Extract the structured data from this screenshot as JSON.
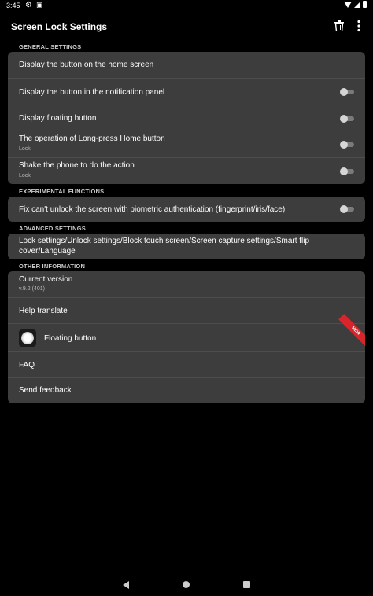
{
  "status_bar": {
    "time": "3:45"
  },
  "app_bar": {
    "title": "Screen Lock Settings"
  },
  "sections": {
    "general": "GENERAL SETTINGS",
    "experimental": "EXPERIMENTAL FUNCTIONS",
    "advanced": "ADVANCED SETTINGS",
    "other": "OTHER INFORMATION"
  },
  "general": {
    "home_button": "Display the button on the home screen",
    "notification_panel": "Display the button in the notification panel",
    "floating_button": "Display floating button",
    "long_press": {
      "label": "The operation of Long-press Home button",
      "value": "Lock"
    },
    "shake": {
      "label": "Shake the phone to do the action",
      "value": "Lock"
    }
  },
  "experimental": {
    "biometric": "Fix can't unlock the screen with biometric authentication (fingerprint/iris/face)"
  },
  "advanced": {
    "line1": "Lock settings/Unlock settings/Block touch screen/Screen capture settings/Smart flip",
    "line2": "cover/Language"
  },
  "other": {
    "version_label": "Current version",
    "version_value": "v.9.2 (401)",
    "help_translate": "Help translate",
    "floating_button": "Floating button",
    "new_badge": "NEW",
    "faq": "FAQ",
    "feedback": "Send feedback"
  },
  "toggles": {
    "notification_panel": false,
    "floating_button": false,
    "long_press": false,
    "shake": false,
    "biometric": false
  },
  "colors": {
    "card": "#3d3d3d",
    "background": "#000000",
    "badge": "#d6262b"
  }
}
